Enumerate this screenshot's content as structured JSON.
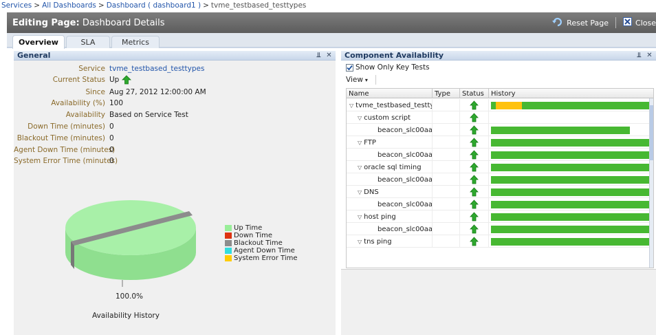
{
  "breadcrumb": {
    "items": [
      "Services",
      "All Dashboards",
      "Dashboard ( dashboard1 )"
    ],
    "current": "tvme_testbased_testtypes",
    "separator": ">"
  },
  "titlebar": {
    "prefix": "Editing Page:",
    "title": "Dashboard Details",
    "reset_label": "Reset Page",
    "close_label": "Close"
  },
  "tabs": [
    "Overview",
    "SLA",
    "Metrics"
  ],
  "general": {
    "title": "General",
    "fields": [
      {
        "label": "Service",
        "value": "tvme_testbased_testtypes"
      },
      {
        "label": "Current Status",
        "value": "Up"
      },
      {
        "label": "Since",
        "value": "Aug 27, 2012 12:00:00 AM"
      },
      {
        "label": "Availability (%)",
        "value": "100"
      },
      {
        "label": "Availability",
        "value": "Based on Service Test"
      },
      {
        "label": "Down Time (minutes)",
        "value": "0"
      },
      {
        "label": "Blackout Time (minutes)",
        "value": "0"
      },
      {
        "label": "Agent Down Time (minutes)",
        "value": "0"
      },
      {
        "label": "System Error Time (minutes)",
        "value": "0"
      }
    ],
    "pie_percent": "100.0%",
    "chart_caption": "Availability History",
    "legend": [
      {
        "label": "Up Time",
        "color": "#99ee99"
      },
      {
        "label": "Down Time",
        "color": "#dd3311"
      },
      {
        "label": "Blackout Time",
        "color": "#8c8c8c"
      },
      {
        "label": "Agent Down Time",
        "color": "#33dddd"
      },
      {
        "label": "System Error Time",
        "color": "#ffcc00"
      }
    ]
  },
  "component": {
    "title": "Component Availability",
    "show_key_tests_label": "Show Only Key Tests",
    "show_key_tests_checked": true,
    "view_label": "View",
    "columns": [
      "Name",
      "Type",
      "Status",
      "History"
    ],
    "rows": [
      {
        "name": "tvme_testbased_testty",
        "status": "up",
        "history": "mixed"
      },
      {
        "name": "custom script",
        "status": "up",
        "history": "none"
      },
      {
        "name": "beacon_slc00aa",
        "status": "up",
        "history": "partial"
      },
      {
        "name": "FTP",
        "status": "up",
        "history": "full"
      },
      {
        "name": "beacon_slc00aa",
        "status": "up",
        "history": "full"
      },
      {
        "name": "oracle sql timing",
        "status": "up",
        "history": "full"
      },
      {
        "name": "beacon_slc00aa",
        "status": "up",
        "history": "full"
      },
      {
        "name": "DNS",
        "status": "up",
        "history": "full"
      },
      {
        "name": "beacon_slc00aa",
        "status": "up",
        "history": "full"
      },
      {
        "name": "host ping",
        "status": "up",
        "history": "full"
      },
      {
        "name": "beacon_slc00aa",
        "status": "up",
        "history": "full"
      },
      {
        "name": "tns ping",
        "status": "up",
        "history": "full"
      }
    ]
  },
  "colors": {
    "up": "#2ea82e",
    "history_green": "#47b832",
    "history_yellow": "#ffc20e"
  }
}
